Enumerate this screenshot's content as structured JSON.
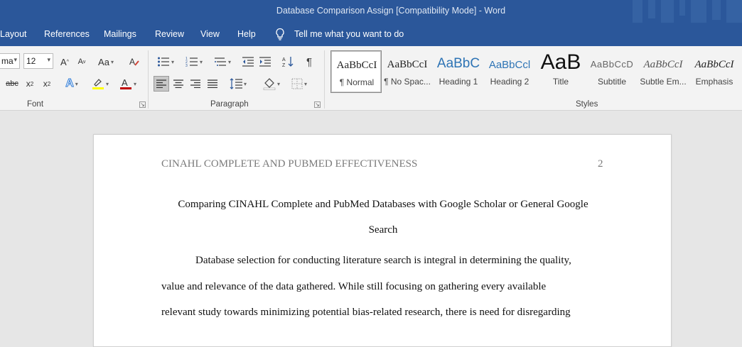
{
  "window": {
    "title": "Database Comparison Assign [Compatibility Mode]  -  Word"
  },
  "tabs": [
    "Layout",
    "References",
    "Mailings",
    "Review",
    "View",
    "Help"
  ],
  "tell_me": "Tell me what you want to do",
  "font": {
    "name_value": "ma",
    "size_value": "12",
    "group_label": "Font"
  },
  "paragraph": {
    "group_label": "Paragraph"
  },
  "styles": {
    "group_label": "Styles",
    "items": [
      {
        "sample": "AaBbCcI",
        "name": "¶ Normal"
      },
      {
        "sample": "AaBbCcI",
        "name": "¶ No Spac..."
      },
      {
        "sample": "AaBbC",
        "name": "Heading 1"
      },
      {
        "sample": "AaBbCcl",
        "name": "Heading 2"
      },
      {
        "sample": "AaB",
        "name": "Title"
      },
      {
        "sample": "AaBbCcD",
        "name": "Subtitle"
      },
      {
        "sample": "AaBbCcI",
        "name": "Subtle Em..."
      },
      {
        "sample": "AaBbCcI",
        "name": "Emphasis"
      }
    ]
  },
  "document": {
    "running_head": "CINAHL COMPLETE AND PUBMED EFFECTIVENESS",
    "page_number": "2",
    "title_line1": "Comparing CINAHL Complete and PubMed Databases with Google Scholar or General Google",
    "title_line2": "Search",
    "body_lines": [
      "Database selection for conducting literature search is integral in determining the quality,",
      "value and relevance of the data gathered. While still focusing on gathering every available",
      "relevant study towards minimizing potential bias-related research, there is need for disregarding"
    ]
  },
  "colors": {
    "ribbon_blue": "#2b579a",
    "font_color_red": "#c00000",
    "highlight_yellow": "#ffff00"
  }
}
